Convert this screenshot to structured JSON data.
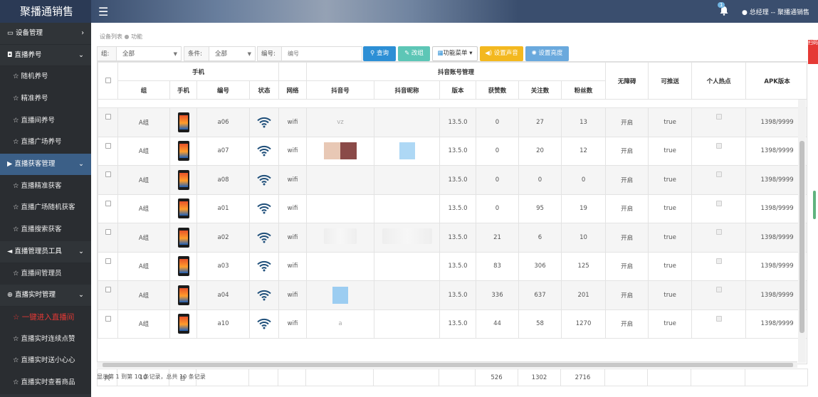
{
  "app": {
    "title": "聚播通销售",
    "user": "总经理 -- 聚播通销售",
    "notification_count": "1",
    "side_tag": "扫码"
  },
  "sidebar": {
    "sections": [
      {
        "label": "设备管理",
        "arrow": "›",
        "active": false,
        "items": []
      },
      {
        "label": "直播养号",
        "arrow": "⌄",
        "active": false,
        "items": [
          "随机养号",
          "精准养号",
          "直播间养号",
          "直播广场养号"
        ]
      },
      {
        "label": "直播获客管理",
        "arrow": "⌄",
        "active": true,
        "items": [
          "直播精准获客",
          "直播广场随机获客",
          "直播搜索获客"
        ]
      },
      {
        "label": "直播管理员工具",
        "arrow": "⌄",
        "active": false,
        "items": [
          "直播间管理员"
        ]
      },
      {
        "label": "直播实时管理",
        "arrow": "⌄",
        "active": false,
        "items": [
          "一键进入直播间",
          "直播实时连续点赞",
          "直播实时送小心心",
          "直播实时查看商品"
        ]
      }
    ]
  },
  "breadcrumb": {
    "a": "设备列表",
    "b": "功能"
  },
  "filter": {
    "group_label": "组:",
    "group_value": "全部",
    "cond_label": "条件:",
    "cond_value": "全部",
    "num_label": "编号:",
    "num_placeholder": "编号",
    "btn_query": "查询",
    "btn_group": "改组",
    "btn_menu": "功能菜单",
    "btn_sound": "设置声音",
    "btn_bright": "设置亮度"
  },
  "table": {
    "group_headers": {
      "phone": "手机",
      "douyin": "抖音账号管理"
    },
    "headers": {
      "group": "组",
      "phone": "手机",
      "number": "编号",
      "status": "状态",
      "network": "网络",
      "dyid": "抖音号",
      "nick": "抖音昵称",
      "version": "版本",
      "likes": "获赞数",
      "follow": "关注数",
      "fans": "粉丝数",
      "barrier": "无障碍",
      "push": "可推送",
      "hotspot": "个人热点",
      "apk": "APK版本"
    },
    "rows": [
      {
        "group": "A组",
        "number": "a06",
        "network": "wifi",
        "dyid": "vz",
        "version": "13.5.0",
        "likes": "0",
        "follow": "27",
        "fans": "13",
        "barrier": "开启",
        "push": "true",
        "apk": "1398/9999"
      },
      {
        "group": "A组",
        "number": "a07",
        "network": "wifi",
        "dyid": "",
        "version": "13.5.0",
        "likes": "0",
        "follow": "20",
        "fans": "12",
        "barrier": "开启",
        "push": "true",
        "apk": "1398/9999"
      },
      {
        "group": "A组",
        "number": "a08",
        "network": "wifi",
        "dyid": "",
        "version": "13.5.0",
        "likes": "0",
        "follow": "0",
        "fans": "0",
        "barrier": "开启",
        "push": "true",
        "apk": "1398/9999"
      },
      {
        "group": "A组",
        "number": "a01",
        "network": "wifi",
        "dyid": "",
        "version": "13.5.0",
        "likes": "0",
        "follow": "95",
        "fans": "19",
        "barrier": "开启",
        "push": "true",
        "apk": "1398/9999"
      },
      {
        "group": "A组",
        "number": "a02",
        "network": "wifi",
        "dyid": "",
        "version": "13.5.0",
        "likes": "21",
        "follow": "6",
        "fans": "10",
        "barrier": "开启",
        "push": "true",
        "apk": "1398/9999"
      },
      {
        "group": "A组",
        "number": "a03",
        "network": "wifi",
        "dyid": "",
        "version": "13.5.0",
        "likes": "83",
        "follow": "306",
        "fans": "125",
        "barrier": "开启",
        "push": "true",
        "apk": "1398/9999"
      },
      {
        "group": "A组",
        "number": "a04",
        "network": "wifi",
        "dyid": "",
        "version": "13.5.0",
        "likes": "336",
        "follow": "637",
        "fans": "201",
        "barrier": "开启",
        "push": "true",
        "apk": "1398/9999"
      },
      {
        "group": "A组",
        "number": "a10",
        "network": "wifi",
        "dyid": "a",
        "version": "13.5.0",
        "likes": "44",
        "follow": "58",
        "fans": "1270",
        "barrier": "开启",
        "push": "true",
        "apk": "1398/9999"
      }
    ],
    "footer": {
      "label": "共",
      "count": "10",
      "unit": "台",
      "likes": "526",
      "follow": "1302",
      "fans": "2716"
    },
    "summary": "显示第 1 到第 10 条记录，总共 10 条记录"
  },
  "colors": {
    "sidebar": "#2f3338",
    "active": "#3b5f87",
    "query": "#2d8fd5",
    "sound": "#f3b81f"
  }
}
